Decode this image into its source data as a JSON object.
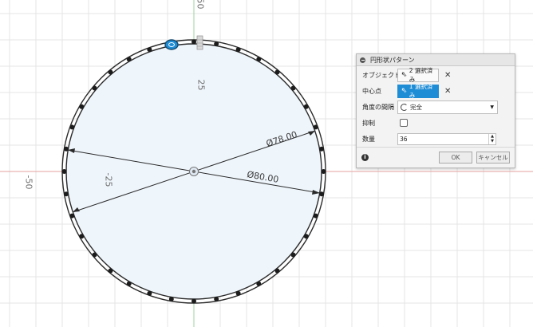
{
  "canvas": {
    "axis_labels": {
      "top": "50",
      "left": "-50",
      "circle_left": "-25",
      "center_vertical": "25"
    },
    "dimensions": {
      "inner_diameter": "Ø78.00",
      "outer_diameter": "Ø80.00"
    },
    "pattern_count_visual": 36,
    "colors": {
      "fill": "#eef5fb",
      "grid": "#e4e4e4",
      "x_axis": "#e7a0a0",
      "y_axis": "#9ed39e",
      "accent": "#1f8dd6"
    }
  },
  "panel": {
    "title": "円形状パターン",
    "rows": {
      "objects": {
        "label": "オブジェクト",
        "value": "2 選択済み"
      },
      "center": {
        "label": "中心点",
        "value": "1 選択済み"
      },
      "angle": {
        "label": "角度の間隔",
        "value": "完全"
      },
      "suppress": {
        "label": "抑制",
        "checked": false
      },
      "quantity": {
        "label": "数量",
        "value": "36"
      }
    },
    "buttons": {
      "ok": "OK",
      "cancel": "キャンセル"
    },
    "icons": {
      "info": "info-icon",
      "clear": "close-icon",
      "cursor": "cursor-icon",
      "angle": "angle-spacing-icon"
    }
  }
}
